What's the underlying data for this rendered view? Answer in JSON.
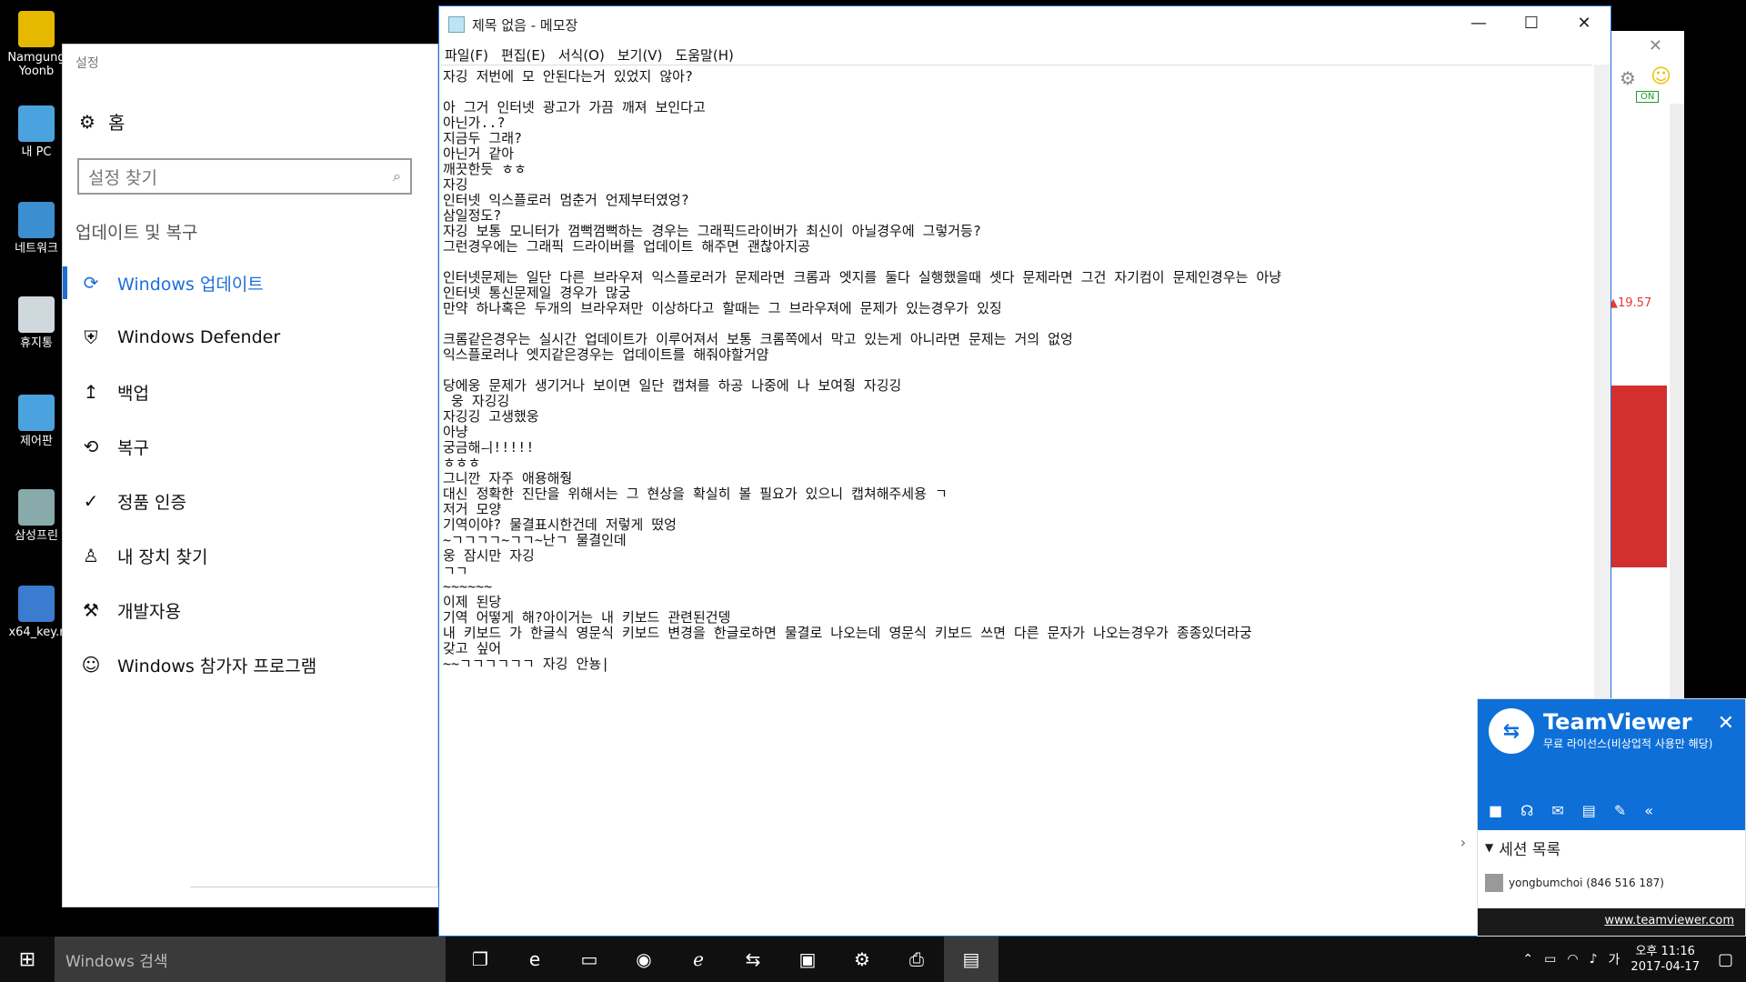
{
  "desktop": {
    "icons": [
      {
        "label": "Namgung Yoonb",
        "icon": "user-folder-icon",
        "color": "#e6b800"
      },
      {
        "label": "내 PC",
        "icon": "computer-icon",
        "color": "#4aa3df"
      },
      {
        "label": "네트워크",
        "icon": "network-icon",
        "color": "#3b8fd0"
      },
      {
        "label": "휴지통",
        "icon": "recycle-bin-icon",
        "color": "#cfd8dc"
      },
      {
        "label": "제어판",
        "icon": "control-panel-icon",
        "color": "#4aa3df"
      },
      {
        "label": "삼성프린",
        "icon": "printer-icon",
        "color": "#8aa"
      },
      {
        "label": "x64_key.r",
        "icon": "file-icon",
        "color": "#3b7bd0"
      }
    ]
  },
  "settings": {
    "window_title": "설정",
    "home_label": "홈",
    "search_placeholder": "설정 찾기",
    "category": "업데이트 및 복구",
    "nav": [
      {
        "label": "Windows 업데이트",
        "icon": "sync-icon",
        "glyph": "⟳",
        "active": true
      },
      {
        "label": "Windows Defender",
        "icon": "shield-icon",
        "glyph": "⛨",
        "active": false
      },
      {
        "label": "백업",
        "icon": "backup-arrow-icon",
        "glyph": "↥",
        "active": false
      },
      {
        "label": "복구",
        "icon": "history-icon",
        "glyph": "⟲",
        "active": false
      },
      {
        "label": "정품 인증",
        "icon": "check-circle-icon",
        "glyph": "✓",
        "active": false
      },
      {
        "label": "내 장치 찾기",
        "icon": "person-location-icon",
        "glyph": "♙",
        "active": false
      },
      {
        "label": "개발자용",
        "icon": "tools-icon",
        "glyph": "⚒",
        "active": false
      },
      {
        "label": "Windows 참가자 프로그램",
        "icon": "person-icon",
        "glyph": "☺",
        "active": false
      }
    ]
  },
  "notepad": {
    "title": "제목 없음 - 메모장",
    "menu": [
      "파일(F)",
      "편집(E)",
      "서식(O)",
      "보기(V)",
      "도움말(H)"
    ],
    "content": "자깅 저번에 모 안된다는거 있었지 않아?\n\n아 그거 인터넷 광고가 가끔 깨져 보인다고\n아닌가..?\n지금두 그래?\n아닌거 같아\n깨끗한듯 ㅎㅎ\n자깅\n인터넷 익스플로러 멈춘거 언제부터였엉?\n삼일정도?\n자깅 보통 모니터가 껌뻑껌뻑하는 경우는 그래픽드라이버가 최신이 아닐경우에 그렇거등?\n그런경우에는 그래픽 드라이버를 업데이트 해주면 괜찮아지공\n\n인터넷문제는 일단 다른 브라우져 익스플로러가 문제라면 크롬과 엣지를 둘다 실행했을때 셋다 문제라면 그건 자기컴이 문제인경우는 아냥\n인터넷 통신문제일 경우가 많궁\n만약 하나혹은 두개의 브라우져만 이상하다고 할때는 그 브라우져에 문제가 있는경우가 있징\n\n크롬같은경우는 실시간 업데이트가 이루어져서 보통 크롬쪽에서 막고 있는게 아니라면 문제는 거의 없엉\n익스플로러나 엣지같은경우는 업데이트를 해줘야할거얌\n\n당에웅 문제가 생기거나 보이면 일단 캡쳐를 하공 나중에 나 보여줭 자깅깅\n 웅 자깅깅\n자깅깅 고생했웅\n아냥\n궁금해ㅢ!!!!!\nㅎㅎㅎ\n그니깐 자주 애용해줭\n대신 정확한 진단을 위해서는 그 현상을 확실히 볼 필요가 있으니 캡쳐해주세용 ㄱ\n저거 모양\n기역이야? 물결표시한건데 저렇게 떴엉\n~ㄱㄱㄱㄱ~ㄱㄱ~난ㄱ 물결인데\n웅 잠시만 자깅\nㄱㄱ\n~~~~~~\n이제 된당\n기역 어떻게 해?아이거는 내 키보드 관련된건뎅\n내 키보드 가 한글식 영문식 키보드 변경을 한글로하면 물결로 나오는데 영문식 키보드 쓰면 다른 문자가 나오는경우가 종종있더라궁\n갖고 싶어\n~~ㄱㄱㄱㄱㄱㄱ 자깅 안뇽|"
  },
  "browser_partial": {
    "on_badge": "ON",
    "price": "▲19.57"
  },
  "teamviewer": {
    "title": "TeamViewer",
    "subtitle": "무료 라이선스(비상업적 사용만 해당)",
    "session_title": "세션 목록",
    "session_user": "yongbumchoi (846 516 187)",
    "link": "www.teamviewer.com"
  },
  "taskbar": {
    "search_placeholder": "Windows 검색",
    "time": "오후 11:16",
    "date": "2017-04-17",
    "ime": "가",
    "apps": [
      {
        "icon": "task-view-icon",
        "glyph": "❐"
      },
      {
        "icon": "edge-icon",
        "glyph": "e"
      },
      {
        "icon": "file-explorer-icon",
        "glyph": "▭"
      },
      {
        "icon": "chrome-icon",
        "glyph": "◉"
      },
      {
        "icon": "internet-explorer-icon",
        "glyph": "ℯ"
      },
      {
        "icon": "teamviewer-icon",
        "glyph": "⇆"
      },
      {
        "icon": "control-panel-icon",
        "glyph": "▣"
      },
      {
        "icon": "settings-gear-icon",
        "glyph": "⚙"
      },
      {
        "icon": "printer-icon",
        "glyph": "⎙"
      },
      {
        "icon": "notepad-icon",
        "glyph": "▤"
      }
    ]
  }
}
